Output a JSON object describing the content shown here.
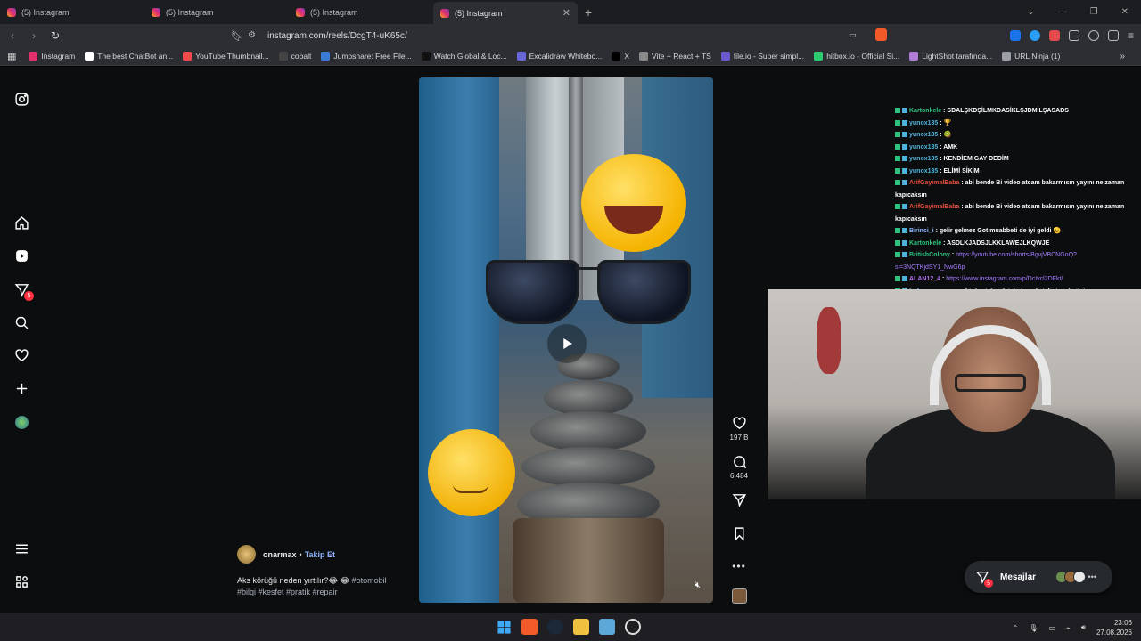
{
  "browser": {
    "tabs": [
      {
        "title": "(5) Instagram",
        "active": false
      },
      {
        "title": "(5) Instagram",
        "active": false
      },
      {
        "title": "(5) Instagram",
        "active": false
      },
      {
        "title": "(5) Instagram",
        "active": true
      }
    ],
    "url": "instagram.com/reels/DcgT4-uK65c/",
    "bookmarks": [
      {
        "label": "Instagram",
        "color": "#e1306c"
      },
      {
        "label": "The best ChatBot an...",
        "color": "#ffffff"
      },
      {
        "label": "YouTube Thumbnail...",
        "color": "#f04b4b"
      },
      {
        "label": "cobalt",
        "color": "#444444"
      },
      {
        "label": "Jumpshare: Free File...",
        "color": "#3a7bd5"
      },
      {
        "label": "Watch Global & Loc...",
        "color": "#111111"
      },
      {
        "label": "Excalidraw Whitebo...",
        "color": "#6965db"
      },
      {
        "label": "X",
        "color": "#000000"
      },
      {
        "label": "Vite + React + TS",
        "color": "#888888"
      },
      {
        "label": "file.io - Super simpl...",
        "color": "#6a5acd"
      },
      {
        "label": "hitbox.io - Official Si...",
        "color": "#2ecc71"
      },
      {
        "label": "LightShot tarafında...",
        "color": "#b07cd8"
      },
      {
        "label": "URL Ninja (1)",
        "color": "#9aa0a6"
      }
    ]
  },
  "sidebar": {
    "messages_badge": "5"
  },
  "reel": {
    "likes": "197 B",
    "comments": "6.484",
    "username": "onarmax",
    "follow_label": "Takip Et",
    "caption_text": "Aks körüğü neden yırtılır?😂 😂",
    "hashtags_line1": "#otomobil",
    "hashtags_line2": "#bilgi #kesfet #pratik #repair"
  },
  "chat": [
    {
      "user": "Kartonkele",
      "color": "#2ec27e",
      "msg": "SDALŞKDŞİLMKDASİKLŞJDMİLŞASADS"
    },
    {
      "user": "yunox135",
      "color": "#4fb3d9",
      "msg": "🏆"
    },
    {
      "user": "yunox135",
      "color": "#4fb3d9",
      "msg": "🥝"
    },
    {
      "user": "yunox135",
      "color": "#4fb3d9",
      "msg": "AMK"
    },
    {
      "user": "yunox135",
      "color": "#4fb3d9",
      "msg": "KENDİEM GAY DEDİM"
    },
    {
      "user": "yunox135",
      "color": "#4fb3d9",
      "msg": "ELİMİ SİKİM"
    },
    {
      "user": "ArifGayimalBaba",
      "color": "#e8503a",
      "msg": "abi bende Bi video atcam bakarmısın yayını ne zaman kapıcaksın"
    },
    {
      "user": "ArifGayimalBaba",
      "color": "#e8503a",
      "msg": "abi bende Bi video atcam bakarmısın yayını ne zaman kapıcaksın"
    },
    {
      "user": "Birinci_i",
      "color": "#8ab4f8",
      "msg": "gelir gelmez Got muabbeti de iyi geldi 🫡"
    },
    {
      "user": "Kartonkele",
      "color": "#2ec27e",
      "msg": "ASDLKJADSJLKKLAWEJLKQWJE"
    },
    {
      "user": "BritishColony",
      "color": "#2ec27e",
      "msg": "https://youtube.com/shorts/BgvjVBCNGoQ?si=3NQTKjdSY1_NwG6p",
      "is_link": true
    },
    {
      "user": "ALAN12_4",
      "color": "#b070e8",
      "msg": "https://www.instagram.com/p/DcIvcl2DFkt/",
      "is_link": true
    },
    {
      "user": "bufavo",
      "color": "#8ab4f8",
      "msg": "ne zaman bir tur istesek işleri vardı. işleri rast gitsin"
    }
  ],
  "messages_pill": {
    "label": "Mesajlar",
    "badge": "5"
  },
  "taskbar": {
    "time": "23:06",
    "date": "27.08.2026"
  }
}
